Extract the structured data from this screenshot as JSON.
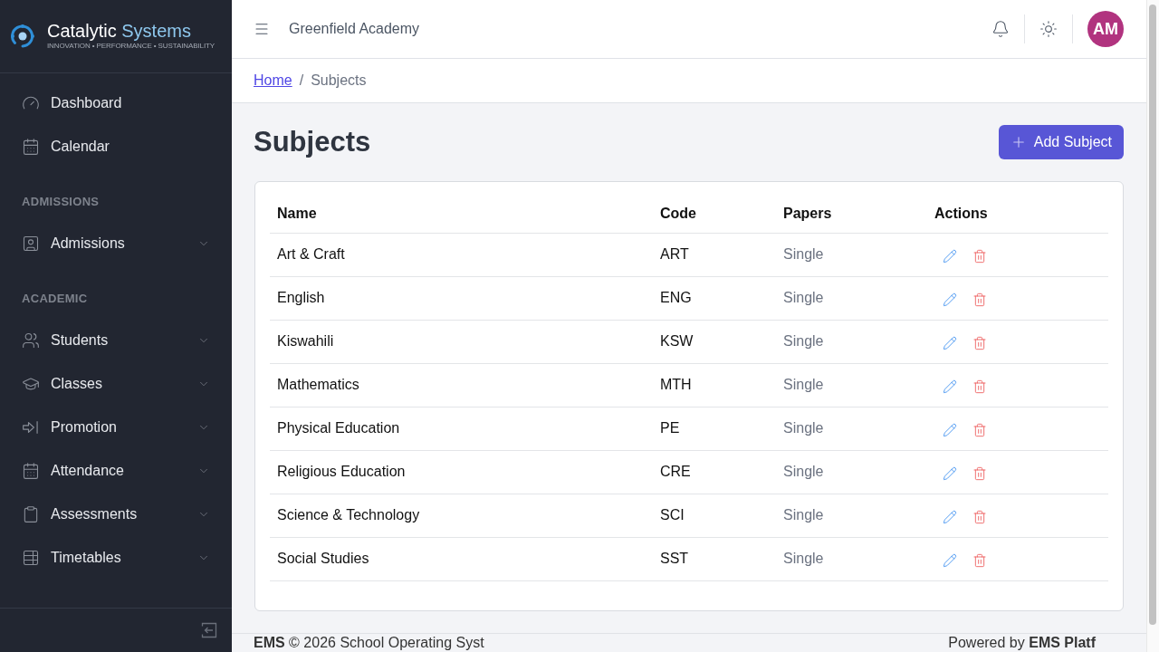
{
  "sidebar": {
    "logo": {
      "words": [
        "Catalytic",
        "Systems"
      ],
      "tagline": "INNOVATION • PERFORMANCE • SUSTAINABILITY"
    },
    "groups": [
      {
        "items": [
          {
            "label": "Dashboard",
            "expandable": false
          },
          {
            "label": "Calendar",
            "expandable": false
          }
        ]
      },
      {
        "heading": "ADMISSIONS",
        "items": [
          {
            "label": "Admissions",
            "expandable": true
          }
        ]
      },
      {
        "heading": "ACADEMIC",
        "items": [
          {
            "label": "Students",
            "expandable": true
          },
          {
            "label": "Classes",
            "expandable": true
          },
          {
            "label": "Promotion",
            "expandable": true
          },
          {
            "label": "Attendance",
            "expandable": true
          },
          {
            "label": "Assessments",
            "expandable": true
          },
          {
            "label": "Timetables",
            "expandable": true
          }
        ]
      }
    ]
  },
  "top_bar": {
    "school": "Greenfield Academy",
    "user_initials": "AM"
  },
  "breadcrumb": {
    "separator": "/",
    "items": [
      {
        "label": "Home",
        "link": true
      },
      {
        "label": "Subjects",
        "link": false
      }
    ]
  },
  "page": {
    "title": "Subjects",
    "add_button": "Add Subject"
  },
  "table": {
    "columns": [
      "Name",
      "Code",
      "Papers",
      "Actions"
    ],
    "rows": [
      {
        "name": "Art & Craft",
        "code": "ART",
        "papers": "Single"
      },
      {
        "name": "English",
        "code": "ENG",
        "papers": "Single"
      },
      {
        "name": "Kiswahili",
        "code": "KSW",
        "papers": "Single"
      },
      {
        "name": "Mathematics",
        "code": "MTH",
        "papers": "Single"
      },
      {
        "name": "Physical Education",
        "code": "PE",
        "papers": "Single"
      },
      {
        "name": "Religious Education",
        "code": "CRE",
        "papers": "Single"
      },
      {
        "name": "Science & Technology",
        "code": "SCI",
        "papers": "Single"
      },
      {
        "name": "Social Studies",
        "code": "SST",
        "papers": "Single"
      }
    ]
  },
  "footer": {
    "left": "**EMS** © 2026 School Operating Syst",
    "right": "Powered by **EMS Platf**"
  }
}
